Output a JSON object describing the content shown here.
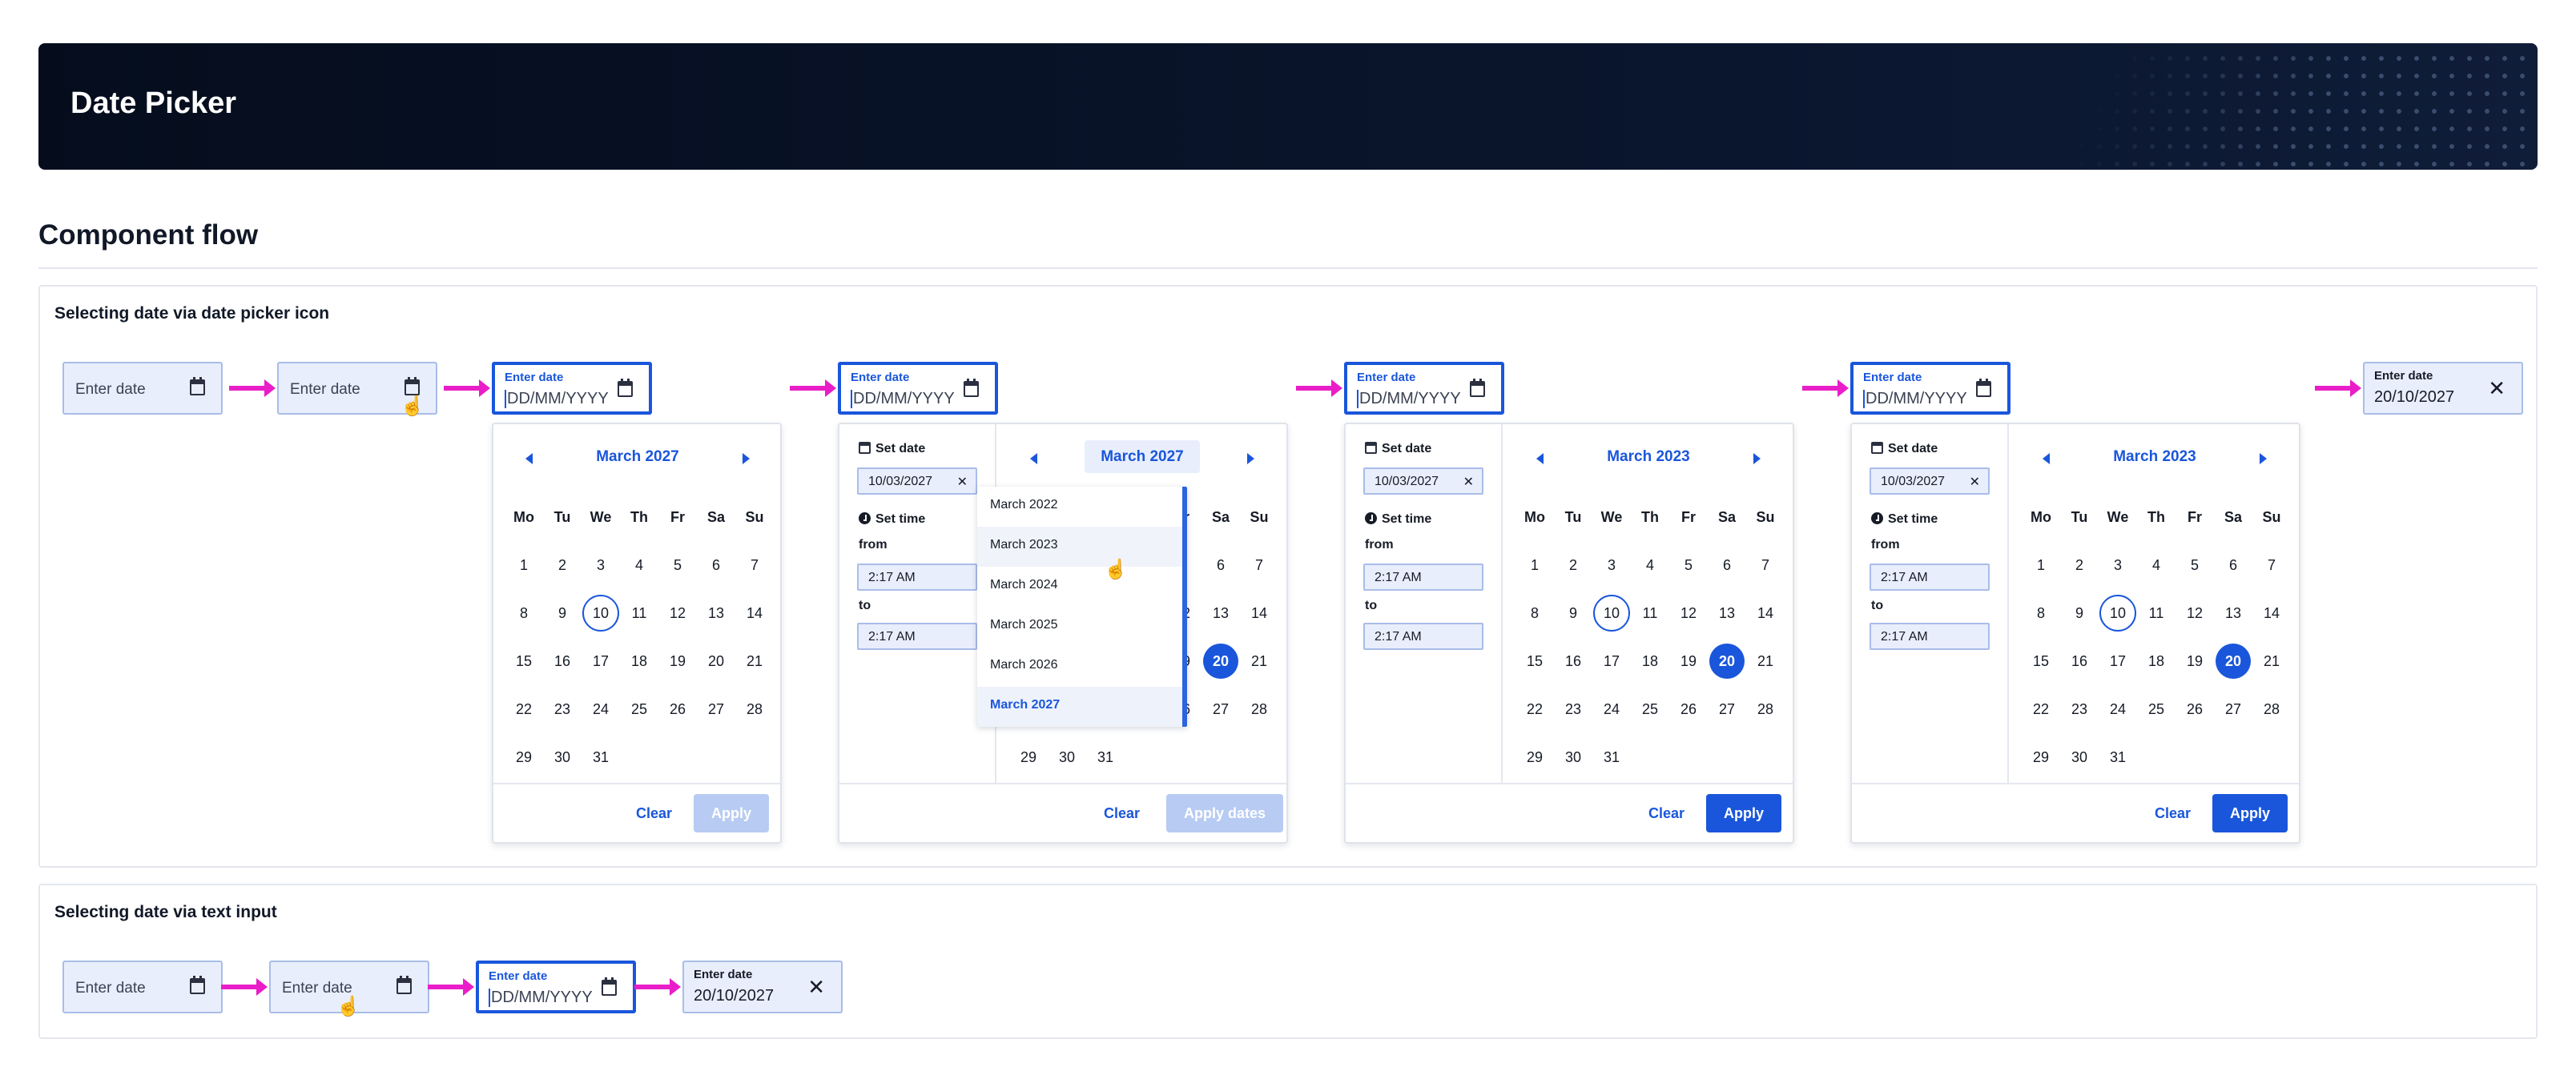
{
  "header": {
    "title": "Date Picker"
  },
  "section": {
    "title": "Component flow"
  },
  "panel1": {
    "title": "Selecting date via date picker icon"
  },
  "panel2": {
    "title": "Selecting date via text input"
  },
  "field": {
    "placeholder": "Enter date",
    "label": "Enter date",
    "format": "DD/MM/YYYY",
    "filled_value": "20/10/2027"
  },
  "weekdays": [
    "Mo",
    "Tu",
    "We",
    "Th",
    "Fr",
    "Sa",
    "Su"
  ],
  "calendars": {
    "c1": {
      "month": "March 2027",
      "clear": "Clear",
      "apply": "Apply",
      "ringed": 10,
      "selected": null
    },
    "c2": {
      "month": "March 2027",
      "clear": "Clear",
      "apply": "Apply dates",
      "ringed": null,
      "selected": 20
    },
    "c3": {
      "month": "March 2023",
      "clear": "Clear",
      "apply": "Apply",
      "ringed": 10,
      "selected": 20
    },
    "c4": {
      "month": "March 2023",
      "clear": "Clear",
      "apply": "Apply",
      "ringed": 10,
      "selected": 20
    }
  },
  "days": [
    [
      1,
      2,
      3,
      4,
      5,
      6,
      7
    ],
    [
      8,
      9,
      10,
      11,
      12,
      13,
      14
    ],
    [
      15,
      16,
      17,
      18,
      19,
      20,
      21
    ],
    [
      22,
      23,
      24,
      25,
      26,
      27,
      28
    ],
    [
      29,
      30,
      31
    ]
  ],
  "days_layout_note_hidden": "",
  "side": {
    "set_date": "Set date",
    "date_value": "10/03/2027",
    "set_time": "Set time",
    "from": "from",
    "to": "to",
    "from_value": "2:17 AM",
    "to_value": "2:17 AM"
  },
  "month_list": [
    "March 2022",
    "March 2023",
    "March 2024",
    "March 2025",
    "March 2026",
    "March 2027"
  ],
  "colors": {
    "accent": "#1a56db",
    "arrow": "#e91ec8",
    "header_bg": "#050d1d"
  }
}
